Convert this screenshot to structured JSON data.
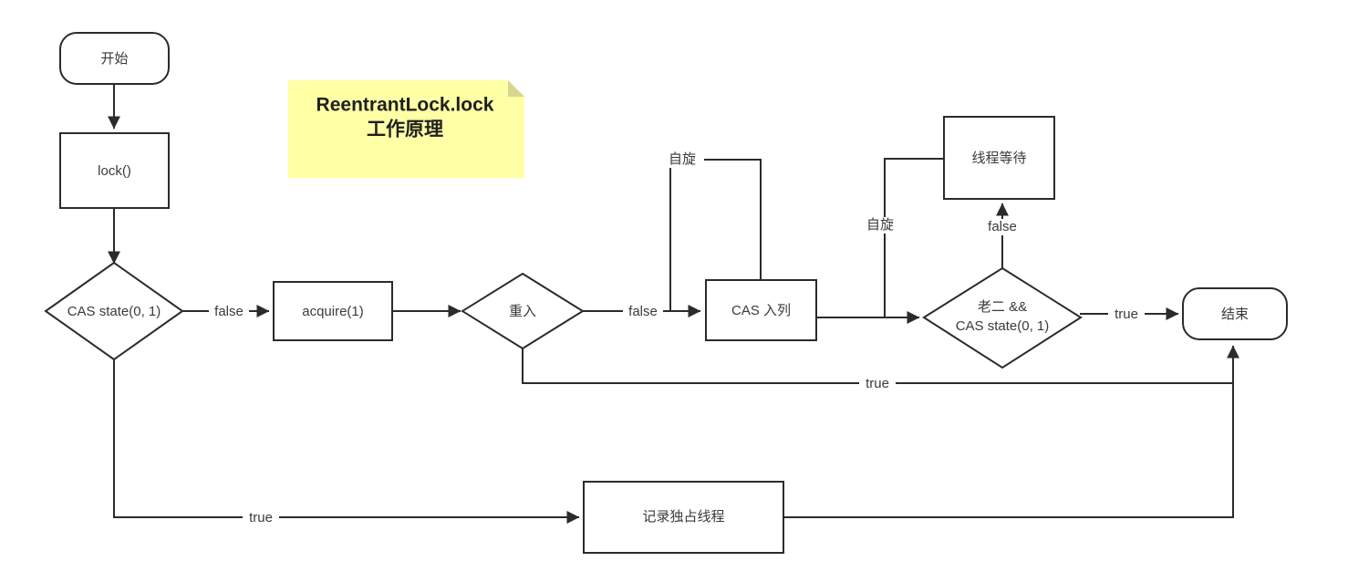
{
  "diagram": {
    "title_note": {
      "line1": "ReentrantLock.lock",
      "line2": "工作原理",
      "background_color": "#ffffa6",
      "fold_color": "#d6d68f"
    },
    "nodes": {
      "start": {
        "label": "开始",
        "shape": "terminator"
      },
      "lock": {
        "label": "lock()",
        "shape": "process"
      },
      "cas_state": {
        "label": "CAS state(0, 1)",
        "shape": "decision"
      },
      "acquire": {
        "label": "acquire(1)",
        "shape": "process"
      },
      "reentrant": {
        "label": "重入",
        "shape": "decision"
      },
      "cas_enqueue": {
        "label": "CAS 入列",
        "shape": "process"
      },
      "thread_wait": {
        "label": "线程等待",
        "shape": "process"
      },
      "second_cas": {
        "label_line1": "老二 &&",
        "label_line2": "CAS state(0, 1)",
        "shape": "decision"
      },
      "record_owner": {
        "label": "记录独占线程",
        "shape": "process"
      },
      "end": {
        "label": "结束",
        "shape": "terminator"
      }
    },
    "edge_labels": {
      "cas_state_false": "false",
      "cas_state_true": "true",
      "reentrant_false": "false",
      "reentrant_true": "true",
      "enqueue_spin": "自旋",
      "second_cas_false": "false",
      "second_cas_true": "true",
      "wait_spin": "自旋"
    },
    "colors": {
      "stroke": "#2b2b2b",
      "text": "#3a3a3a",
      "background": "#ffffff"
    }
  }
}
